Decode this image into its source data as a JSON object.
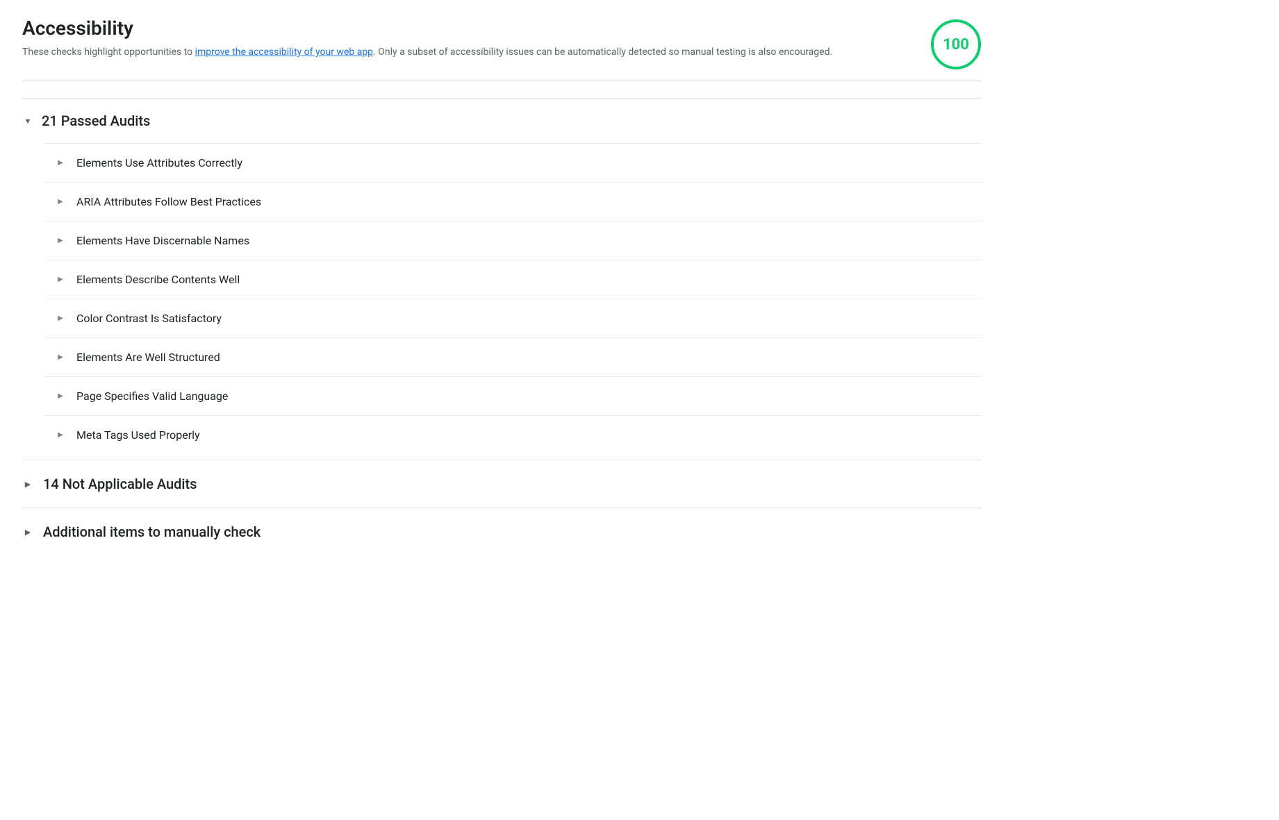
{
  "header": {
    "title": "Accessibility",
    "description_prefix": "These checks highlight opportunities to ",
    "description_link_text": "improve the accessibility of your web app",
    "description_link_href": "#",
    "description_suffix": ". Only a subset of accessibility issues can be automatically detected so manual testing is also encouraged.",
    "score": "100",
    "score_color": "#0cce6b"
  },
  "passed_audits": {
    "label": "21 Passed Audits",
    "chevron": "down",
    "items": [
      {
        "label": "Elements Use Attributes Correctly"
      },
      {
        "label": "ARIA Attributes Follow Best Practices"
      },
      {
        "label": "Elements Have Discernable Names"
      },
      {
        "label": "Elements Describe Contents Well"
      },
      {
        "label": "Color Contrast Is Satisfactory"
      },
      {
        "label": "Elements Are Well Structured"
      },
      {
        "label": "Page Specifies Valid Language"
      },
      {
        "label": "Meta Tags Used Properly"
      }
    ]
  },
  "not_applicable": {
    "label": "14 Not Applicable Audits",
    "chevron": "right"
  },
  "manual_check": {
    "label": "Additional items to manually check",
    "chevron": "right"
  }
}
